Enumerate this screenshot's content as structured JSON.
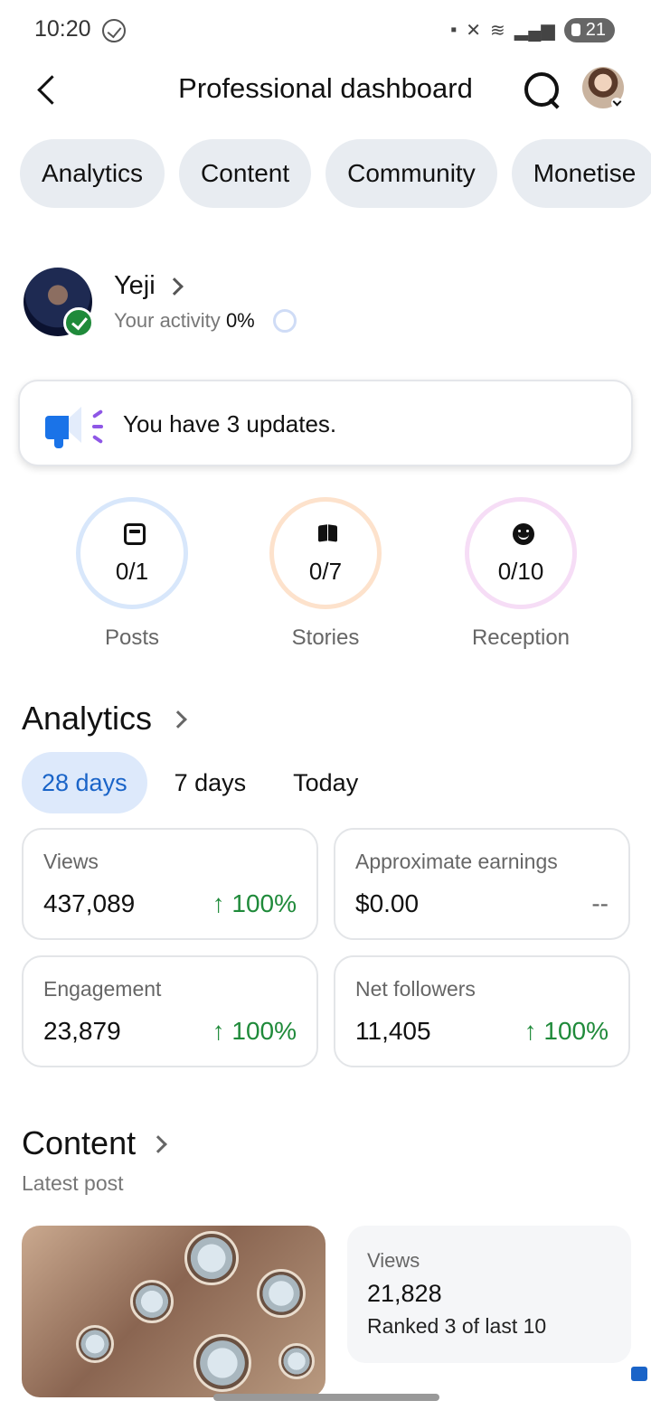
{
  "status_bar": {
    "time": "10:20",
    "battery": "21"
  },
  "header": {
    "title": "Professional dashboard"
  },
  "tabs": [
    "Analytics",
    "Content",
    "Community",
    "Monetise"
  ],
  "profile": {
    "name": "Yeji",
    "activity_label": "Your activity",
    "activity_value": "0%"
  },
  "updates": {
    "text": "You have 3 updates."
  },
  "stats": [
    {
      "value": "0/1",
      "label": "Posts",
      "icon": "post-icon",
      "color": "#d8e7fb"
    },
    {
      "value": "0/7",
      "label": "Stories",
      "icon": "book-icon",
      "color": "#fde2cc"
    },
    {
      "value": "0/10",
      "label": "Reception",
      "icon": "smile-icon",
      "color": "#f6ddf6"
    }
  ],
  "analytics": {
    "title": "Analytics",
    "ranges": [
      "28 days",
      "7 days",
      "Today"
    ],
    "selected_range": "28 days",
    "metrics": [
      {
        "label": "Views",
        "value": "437,089",
        "delta": "↑ 100%"
      },
      {
        "label": "Approximate earnings",
        "value": "$0.00",
        "delta": "--"
      },
      {
        "label": "Engagement",
        "value": "23,879",
        "delta": "↑ 100%"
      },
      {
        "label": "Net followers",
        "value": "11,405",
        "delta": "↑ 100%"
      }
    ]
  },
  "content": {
    "title": "Content",
    "subtitle": "Latest post",
    "views_label": "Views",
    "views_value": "21,828",
    "rank": "Ranked 3 of last 10"
  },
  "colors": {
    "accent": "#1a64c8",
    "positive": "#1f8a3a",
    "chip_bg": "#e8ecf1"
  }
}
